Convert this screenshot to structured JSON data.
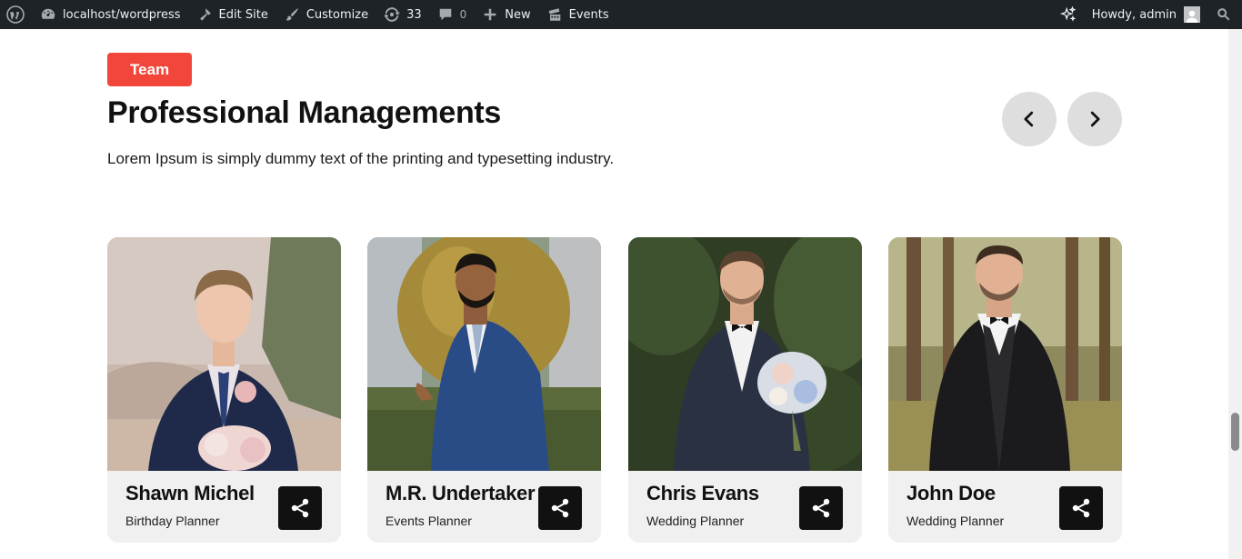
{
  "adminbar": {
    "site": "localhost/wordpress",
    "edit_site": "Edit Site",
    "customize": "Customize",
    "updates_count": "33",
    "comments_count": "0",
    "new": "New",
    "events": "Events",
    "howdy": "Howdy, admin"
  },
  "section": {
    "tag": "Team",
    "title": "Professional Managements",
    "subtitle": "Lorem Ipsum is simply dummy text of the printing and typesetting industry."
  },
  "team": [
    {
      "name": "Shawn Michel",
      "role": "Birthday Planner"
    },
    {
      "name": "M.R. Undertaker",
      "role": "Events Planner"
    },
    {
      "name": "Chris Evans",
      "role": "Wedding Planner"
    },
    {
      "name": "John Doe",
      "role": "Wedding Planner"
    }
  ],
  "colors": {
    "adminbar_bg": "#1d2327",
    "tag_bg": "#f2463b",
    "share_bg": "#111111",
    "card_bg": "#f0f0f0",
    "nav_btn_bg": "#dedede"
  }
}
